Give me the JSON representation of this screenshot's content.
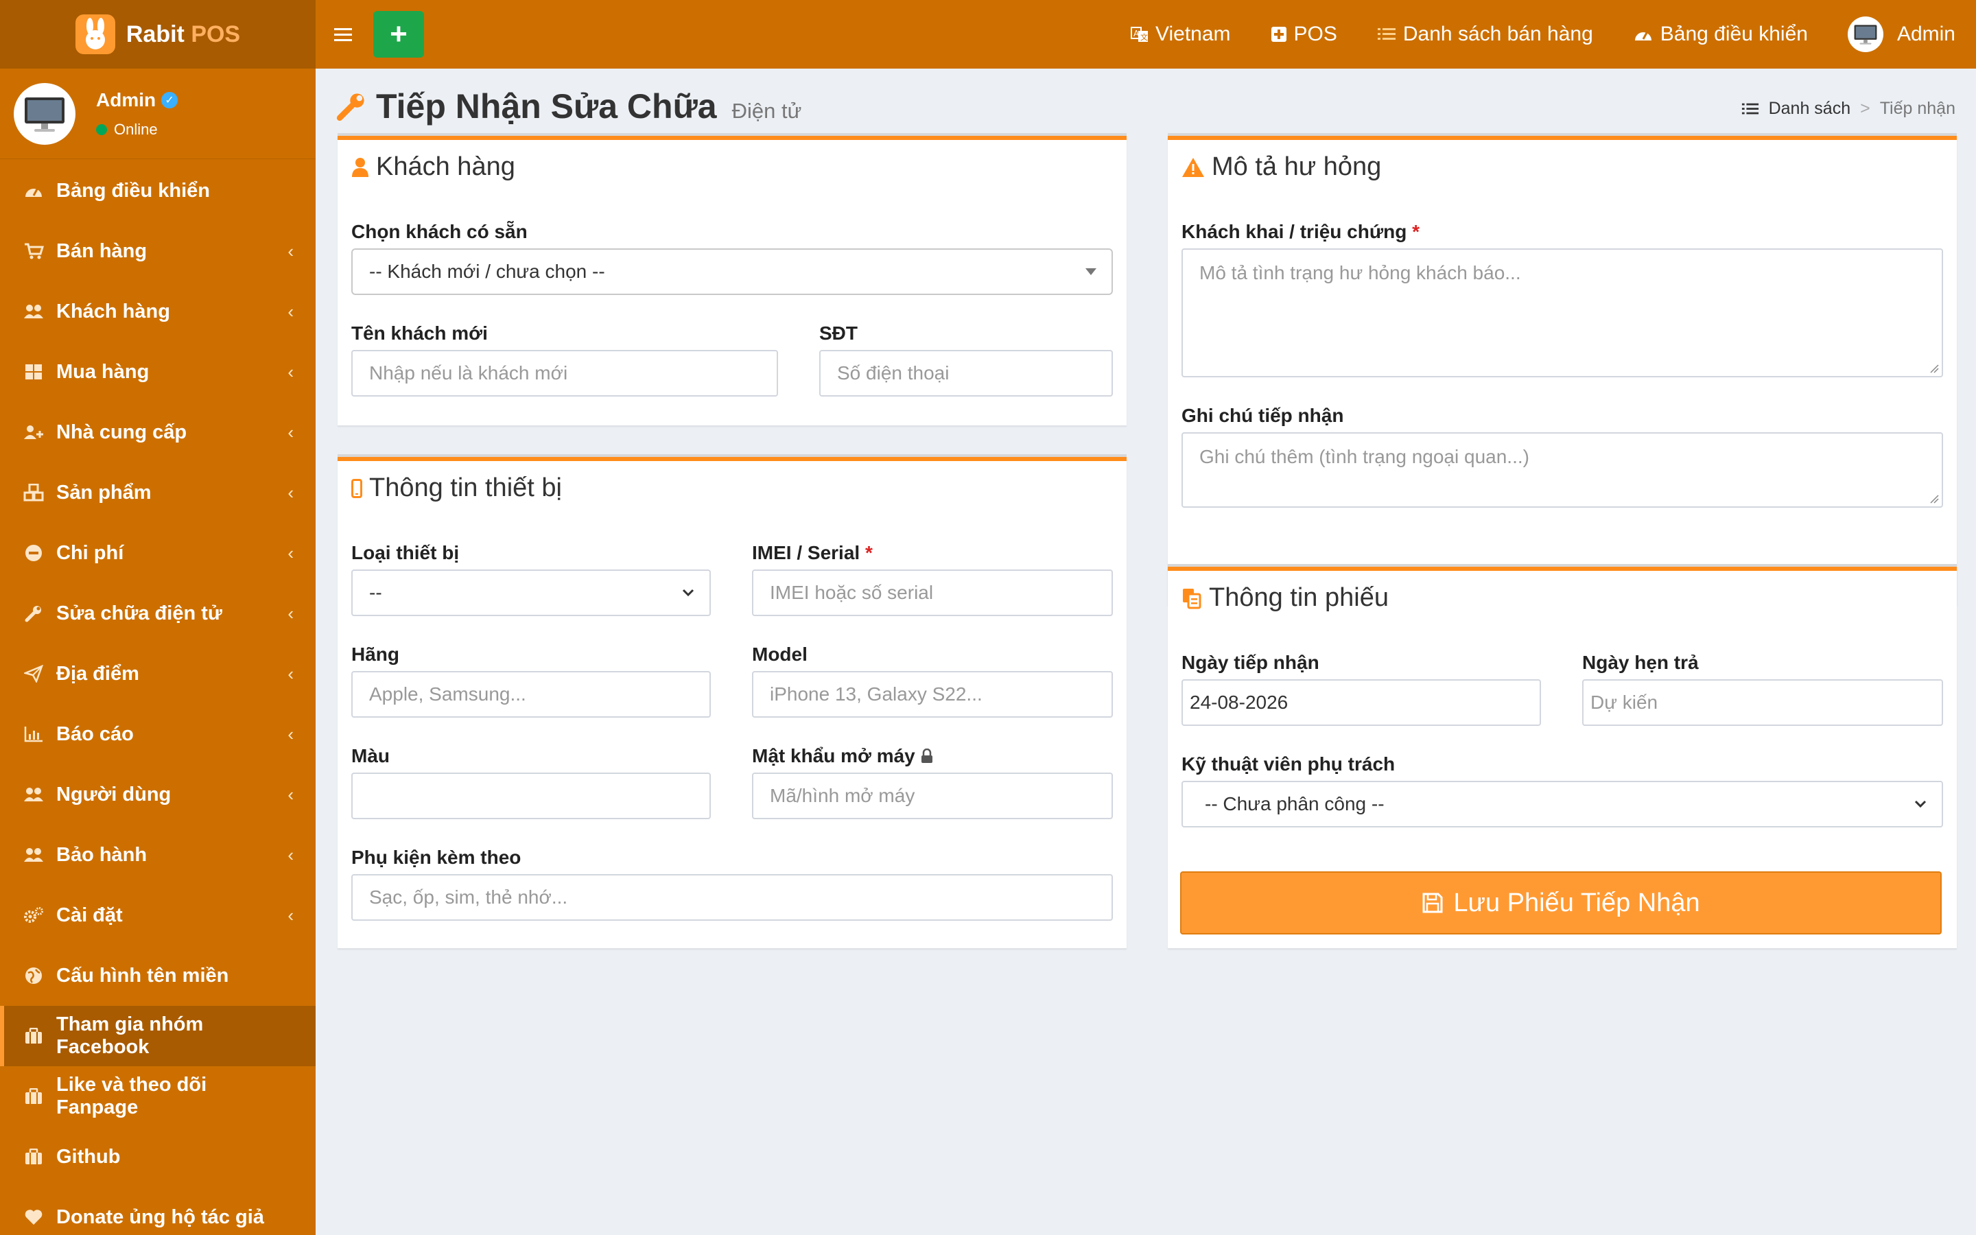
{
  "app": {
    "logo_main": "Rabit",
    "logo_accent": "POS"
  },
  "user": {
    "name": "Admin",
    "status": "Online"
  },
  "sidebar": {
    "items": [
      {
        "label": "Bảng điều khiển",
        "icon": "dashboard-icon",
        "has_children": false
      },
      {
        "label": "Bán hàng",
        "icon": "cart-icon",
        "has_children": true
      },
      {
        "label": "Khách hàng",
        "icon": "users-icon",
        "has_children": true
      },
      {
        "label": "Mua hàng",
        "icon": "grid-icon",
        "has_children": true
      },
      {
        "label": "Nhà cung cấp",
        "icon": "user-plus-icon",
        "has_children": true
      },
      {
        "label": "Sản phẩm",
        "icon": "cubes-icon",
        "has_children": true
      },
      {
        "label": "Chi phí",
        "icon": "minus-circle-icon",
        "has_children": true
      },
      {
        "label": "Sửa chữa điện tử",
        "icon": "wrench-icon",
        "has_children": true
      },
      {
        "label": "Địa điểm",
        "icon": "paper-plane-icon",
        "has_children": true
      },
      {
        "label": "Báo cáo",
        "icon": "bar-chart-icon",
        "has_children": true
      },
      {
        "label": "Người dùng",
        "icon": "users-icon",
        "has_children": true
      },
      {
        "label": "Bảo hành",
        "icon": "users-icon",
        "has_children": true
      },
      {
        "label": "Cài đặt",
        "icon": "gears-icon",
        "has_children": true
      },
      {
        "label": "Cấu hình tên miền",
        "icon": "globe-icon",
        "has_children": false
      },
      {
        "label": "Tham gia nhóm Facebook",
        "icon": "briefcase-icon",
        "has_children": false,
        "active": true
      },
      {
        "label": "Like và theo dõi Fanpage",
        "icon": "briefcase-icon",
        "has_children": false
      },
      {
        "label": "Github",
        "icon": "briefcase-icon",
        "has_children": false
      },
      {
        "label": "Donate ủng hộ tác giả",
        "icon": "heart-icon",
        "has_children": false
      }
    ]
  },
  "topnav": {
    "add_label": "+",
    "links": {
      "language": "Vietnam",
      "pos": "POS",
      "sales_list": "Danh sách bán hàng",
      "dashboard": "Bảng điều khiển",
      "user": "Admin"
    }
  },
  "page": {
    "title": "Tiếp Nhận Sửa Chữa",
    "subtitle": "Điện tử",
    "breadcrumb": {
      "list": "Danh sách",
      "sep": ">",
      "current": "Tiếp nhận"
    }
  },
  "customer": {
    "title": "Khách hàng",
    "select_label": "Chọn khách có sẵn",
    "select_value": "-- Khách mới / chưa chọn --",
    "name_label": "Tên khách mới",
    "name_placeholder": "Nhập nếu là khách mới",
    "phone_label": "SĐT",
    "phone_placeholder": "Số điện thoại"
  },
  "device": {
    "title": "Thông tin thiết bị",
    "type_label": "Loại thiết bị",
    "type_value": "--",
    "imei_label": "IMEI / Serial",
    "imei_placeholder": "IMEI hoặc số serial",
    "brand_label": "Hãng",
    "brand_placeholder": "Apple, Samsung...",
    "model_label": "Model",
    "model_placeholder": "iPhone 13, Galaxy S22...",
    "color_label": "Màu",
    "color_value": "",
    "password_label": "Mật khẩu mở máy",
    "password_placeholder": "Mã/hình mở máy",
    "accessories_label": "Phụ kiện kèm theo",
    "accessories_placeholder": "Sạc, ốp, sim, thẻ nhớ..."
  },
  "damage": {
    "title": "Mô tả hư hỏng",
    "symptom_label": "Khách khai / triệu chứng",
    "symptom_placeholder": "Mô tả tình trạng hư hỏng khách báo...",
    "note_label": "Ghi chú tiếp nhận",
    "note_placeholder": "Ghi chú thêm (tình trạng ngoại quan...)"
  },
  "ticket": {
    "title": "Thông tin phiếu",
    "received_label": "Ngày tiếp nhận",
    "received_value": "24-08-2026",
    "return_label": "Ngày hẹn trả",
    "return_placeholder": "Dự kiến",
    "tech_label": "Kỹ thuật viên phụ trách",
    "tech_value": "-- Chưa phân công --"
  },
  "save_label": "Lưu Phiếu Tiếp Nhận",
  "required_mark": "*",
  "colors": {
    "sidebar": "#cc6f00",
    "sidebar_dark": "#a85b00",
    "accent": "#ff9a33",
    "add_button": "#1ea64a",
    "box_border": "#ff8c1a"
  }
}
